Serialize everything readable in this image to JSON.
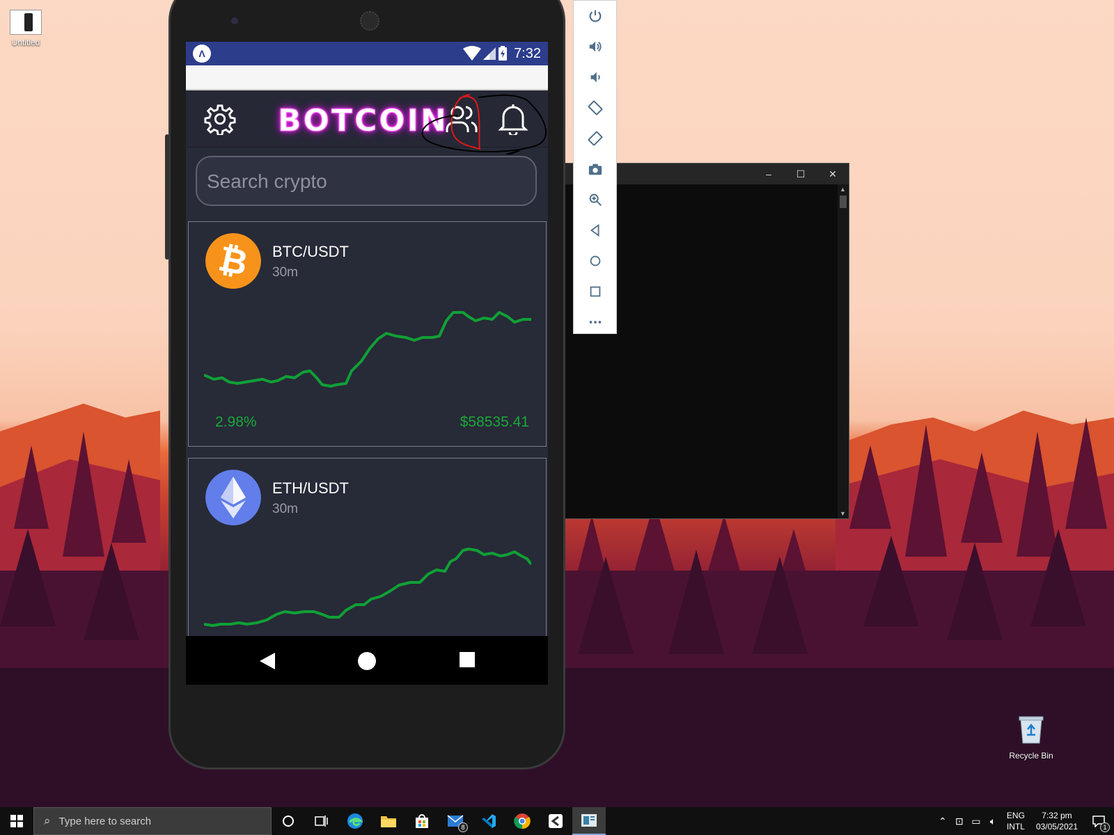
{
  "desktop": {
    "icons": [
      {
        "label": "Untitled"
      },
      {
        "label": "Recycle Bin"
      }
    ]
  },
  "emulator_toolbar": {
    "tools": [
      "power-icon",
      "volume-up-icon",
      "volume-down-icon",
      "rotate-left-icon",
      "rotate-right-icon",
      "camera-icon",
      "zoom-icon",
      "back-icon",
      "home-icon",
      "overview-icon",
      "more-icon"
    ]
  },
  "console_window": {
    "controls": [
      "–",
      "☐",
      "✕"
    ]
  },
  "phone": {
    "status_bar": {
      "time": "7:32",
      "app_badge": "Λ"
    },
    "app": {
      "brand": "BOTCOIN",
      "search_placeholder": "Search crypto",
      "cards": [
        {
          "pair": "BTC/USDT",
          "interval": "30m",
          "change": "2.98%",
          "price": "$58535.41",
          "coin_color": "#f7931a"
        },
        {
          "pair": "ETH/USDT",
          "interval": "30m",
          "coin_color": "#627eea"
        }
      ],
      "accent_green": "#1aa83a",
      "brand_glow": "#e022e0"
    }
  },
  "taskbar": {
    "search_placeholder": "Type here to search",
    "mail_badge": "8",
    "tray": {
      "lang_line1": "ENG",
      "lang_line2": "INTL",
      "time": "7:32 pm",
      "date": "03/05/2021",
      "notif_badge": "1"
    }
  }
}
